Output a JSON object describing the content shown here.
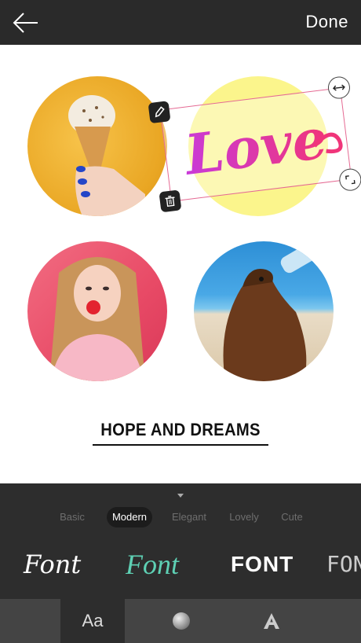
{
  "header": {
    "back_icon": "arrow-left-icon",
    "done_label": "Done"
  },
  "canvas": {
    "sticker_text": "Love",
    "caption": "HOPE AND DREAMS",
    "colors": {
      "sticker_frame": "#e56a93",
      "yellow_circle": "#fbf58c",
      "love_text": "#e53aa6"
    },
    "handles": [
      "pencil-icon",
      "trash-icon",
      "resize-horizontal-icon",
      "scale-icon"
    ]
  },
  "panel": {
    "collapse_icon": "caret-down-icon",
    "tabs": [
      {
        "label": "Basic",
        "active": false
      },
      {
        "label": "Modern",
        "active": true
      },
      {
        "label": "Elegant",
        "active": false
      },
      {
        "label": "Lovely",
        "active": false
      },
      {
        "label": "Cute",
        "active": false
      }
    ],
    "font_samples": [
      {
        "label": "Font",
        "color": "#ffffff"
      },
      {
        "label": "Font",
        "color": "#5ed0b4"
      },
      {
        "label": "FONT",
        "color": "#ffffff"
      },
      {
        "label": "FONT",
        "color": "#cccccc"
      }
    ]
  },
  "bottom_bar": {
    "items": [
      {
        "label": "Aa",
        "name": "text-style-tab",
        "active": true
      },
      {
        "label": "",
        "name": "color-tab",
        "icon": "color-circle-icon",
        "active": false
      },
      {
        "label": "",
        "name": "font-tab",
        "icon": "letter-a-icon",
        "active": false
      }
    ]
  }
}
